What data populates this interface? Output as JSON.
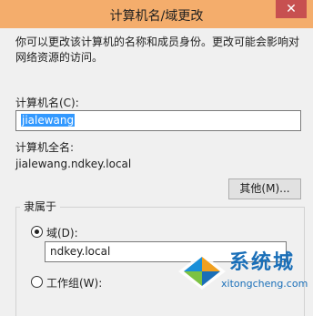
{
  "window": {
    "title": "计算机名/域更改",
    "close_glyph": "✕"
  },
  "description": "你可以更改该计算机的名称和成员身份。更改可能会影响对网络资源的访问。",
  "computer_name": {
    "label": "计算机名(C):",
    "value": "jialewang"
  },
  "full_name": {
    "label": "计算机全名:",
    "value": "jialewang.ndkey.local"
  },
  "more_button": "其他(M)...",
  "member_of": {
    "title": "隶属于",
    "domain_label": "域(D):",
    "domain_value": "ndkey.local",
    "domain_selected": true,
    "workgroup_label": "工作组(W):"
  },
  "watermark": {
    "logo": "系统城",
    "url": "xitongcheng.com"
  },
  "colors": {
    "title_bar": "#f4ad6c",
    "close_button": "#c75050",
    "selection": "#3399ff",
    "watermark": "#1a6fb8"
  }
}
